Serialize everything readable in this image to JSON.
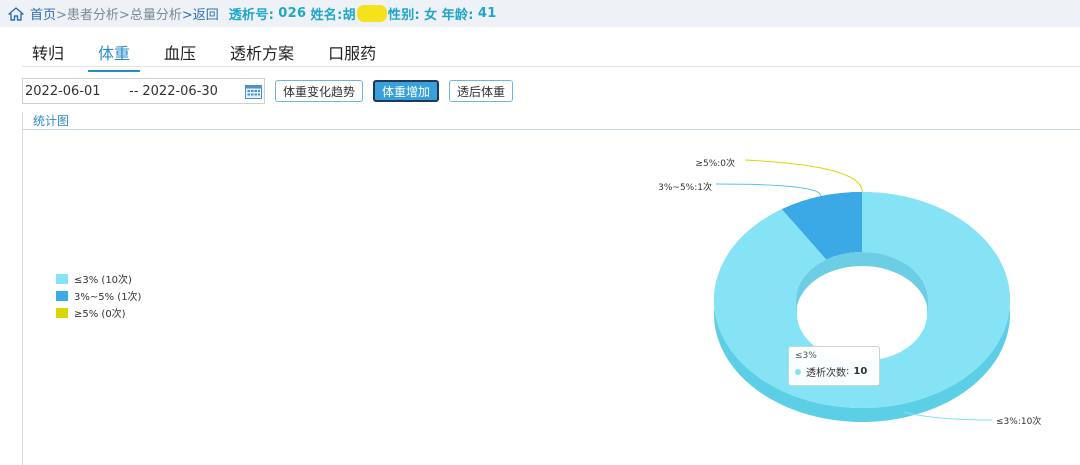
{
  "breadcrumb": {
    "home": "首页",
    "level1": ">患者分析>",
    "level2": "总量分析",
    "back": ">返回",
    "dialysis_no_label": "透析号:",
    "dialysis_no": "026",
    "name_label": "姓名:",
    "name": "胡",
    "gender_label": "性别:",
    "gender": "女",
    "age_label": "年龄:",
    "age": "41"
  },
  "tabs": [
    {
      "label": "转归",
      "active": false
    },
    {
      "label": "体重",
      "active": true
    },
    {
      "label": "血压",
      "active": false
    },
    {
      "label": "透析方案",
      "active": false
    },
    {
      "label": "口服药",
      "active": false
    }
  ],
  "filter": {
    "start_date": "2022-06-01",
    "separator": "--",
    "end_date": "2022-06-30"
  },
  "buttons": {
    "trend": "体重变化趋势",
    "increase": "体重增加",
    "post": "透后体重"
  },
  "panel_title": "统计图",
  "colors": {
    "accent": "#2a8ec6",
    "slice_le3": "#86e3f6",
    "slice_3to5": "#3aa9e6",
    "slice_ge5": "#d8d800"
  },
  "chart_data": {
    "type": "pie",
    "style": "3d-donut",
    "title": "",
    "legend_position": "left",
    "categories": [
      "≤3%",
      "3%~5%",
      "≥5%"
    ],
    "values": [
      10,
      1,
      0
    ],
    "value_unit": "次",
    "legend_labels": [
      "≤3% (10次)",
      "3%~5% (1次)",
      "≥5% (0次)"
    ],
    "slice_labels": [
      "≤3%:10次",
      "3%~5%:1次",
      "≥5%:0次"
    ],
    "tooltip": {
      "name": "≤3%",
      "series": "透析次数",
      "value": 10
    }
  }
}
